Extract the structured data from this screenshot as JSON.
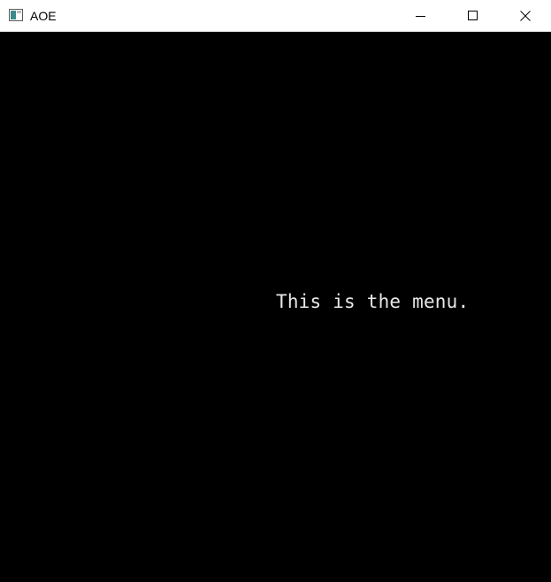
{
  "window": {
    "title": "AOE",
    "icon": "app-window-icon",
    "controls": {
      "minimize_icon": "minimize-icon",
      "maximize_icon": "maximize-icon",
      "close_icon": "close-icon"
    }
  },
  "canvas": {
    "background": "#000000",
    "text_color": "#e8e8e8",
    "message": "This is the menu."
  }
}
